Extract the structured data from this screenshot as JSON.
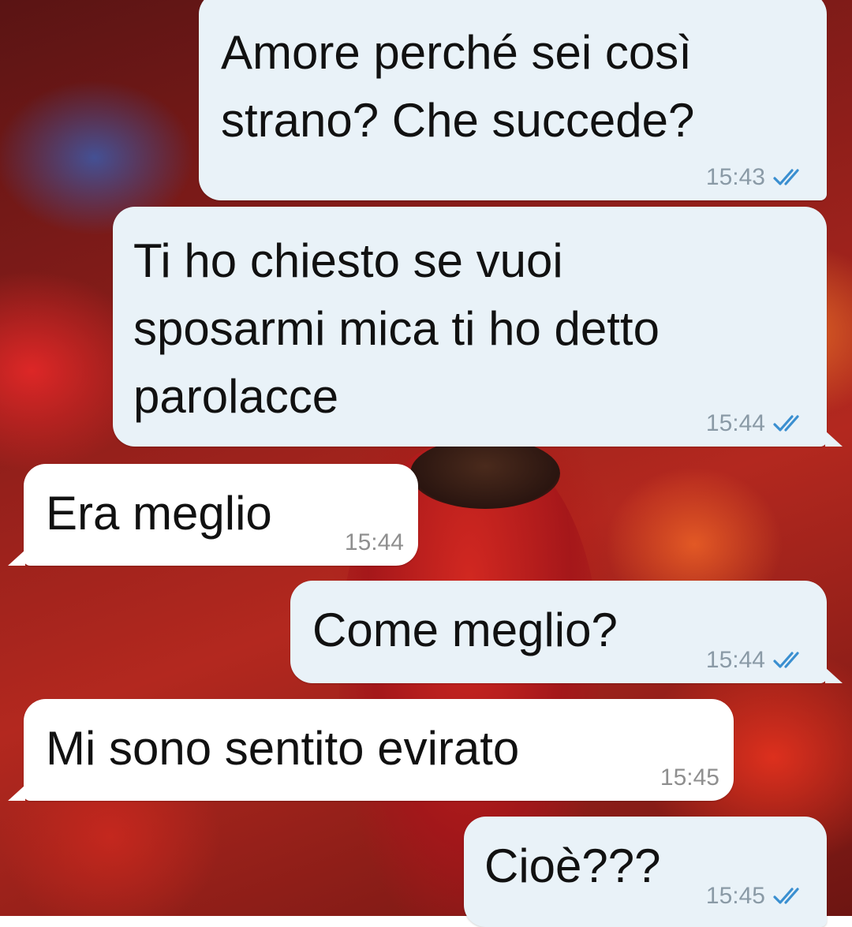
{
  "messages": [
    {
      "direction": "out",
      "text": "Amore perché sei così\nstrano? Che succede?",
      "time": "15:43",
      "status": "read-ticks-icon"
    },
    {
      "direction": "out",
      "text": "Ti ho chiesto se vuoi\nsposarmi mica ti ho detto\nparolacce",
      "time": "15:44",
      "status": "read-ticks-icon"
    },
    {
      "direction": "in",
      "text": "Era meglio",
      "time": "15:44"
    },
    {
      "direction": "out",
      "text": "Come meglio?",
      "time": "15:44",
      "status": "read-ticks-icon"
    },
    {
      "direction": "in",
      "text": "Mi sono sentito evirato",
      "time": "15:45"
    },
    {
      "direction": "out",
      "text": "Cioè???",
      "time": "15:45",
      "status": "read-ticks-icon"
    }
  ],
  "colors": {
    "outgoing_bubble": "#e9f2f8",
    "incoming_bubble": "#ffffff",
    "read_ticks": "#3a8fd0",
    "timestamp": "#8a9aa6"
  }
}
